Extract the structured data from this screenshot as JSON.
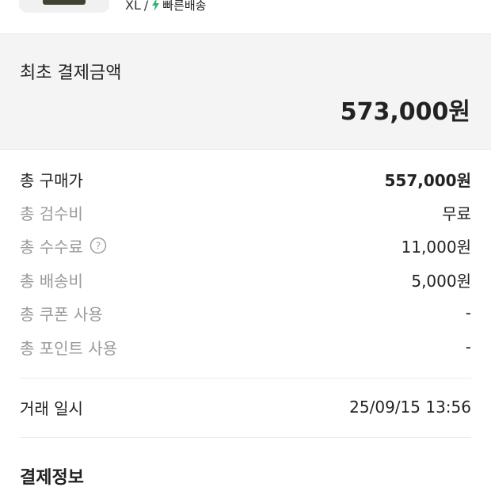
{
  "product": {
    "size": "XL",
    "separator": "/",
    "delivery_label": "빠른배송",
    "bolt_color": "#31b46e"
  },
  "initial_payment": {
    "label": "최초 결제금액",
    "amount": "573,000원"
  },
  "breakdown": [
    {
      "label": "총 구매가",
      "value": "557,000원"
    },
    {
      "label": "총 검수비",
      "value": "무료"
    },
    {
      "label": "총 수수료",
      "value": "11,000원",
      "icon": "help-icon"
    },
    {
      "label": "총 배송비",
      "value": "5,000원"
    },
    {
      "label": "총 쿠폰 사용",
      "value": "-"
    },
    {
      "label": "총 포인트 사용",
      "value": "-"
    }
  ],
  "transaction": {
    "label": "거래 일시",
    "value": "25/09/15 13:56"
  },
  "payment_info": {
    "title": "결제정보"
  },
  "colors": {
    "panel_bg": "#f4f4f4",
    "muted_text": "#9a9a9a",
    "primary_text": "#222222"
  }
}
